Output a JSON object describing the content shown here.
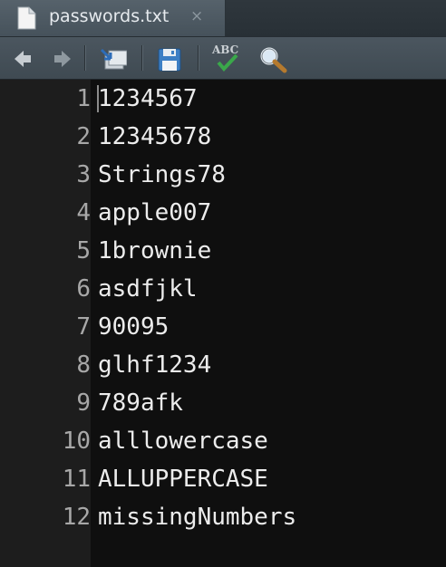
{
  "tab": {
    "title": "passwords.txt",
    "close_glyph": "×"
  },
  "toolbar": {
    "buttons": [
      "arrow-left-icon",
      "arrow-right-icon",
      "go-to-directory-icon",
      "save-icon",
      "spellcheck-icon",
      "search-icon"
    ],
    "spellcheck_text": "ABC"
  },
  "editor": {
    "lines": [
      {
        "number": "1",
        "text": "1234567"
      },
      {
        "number": "2",
        "text": "12345678"
      },
      {
        "number": "3",
        "text": "Strings78"
      },
      {
        "number": "4",
        "text": "apple007"
      },
      {
        "number": "5",
        "text": "1brownie"
      },
      {
        "number": "6",
        "text": "asdfjkl"
      },
      {
        "number": "7",
        "text": "90095"
      },
      {
        "number": "8",
        "text": "glhf1234"
      },
      {
        "number": "9",
        "text": "789afk"
      },
      {
        "number": "10",
        "text": "alllowercase"
      },
      {
        "number": "11",
        "text": "ALLUPPERCASE"
      },
      {
        "number": "12",
        "text": "missingNumbers"
      }
    ]
  },
  "colors": {
    "editor_background": "#0f0f0f",
    "gutter_background": "#1d1d1d",
    "line_number": "#a8a8a8",
    "text": "#ececec",
    "spellcheck_green": "#3aa84a"
  }
}
